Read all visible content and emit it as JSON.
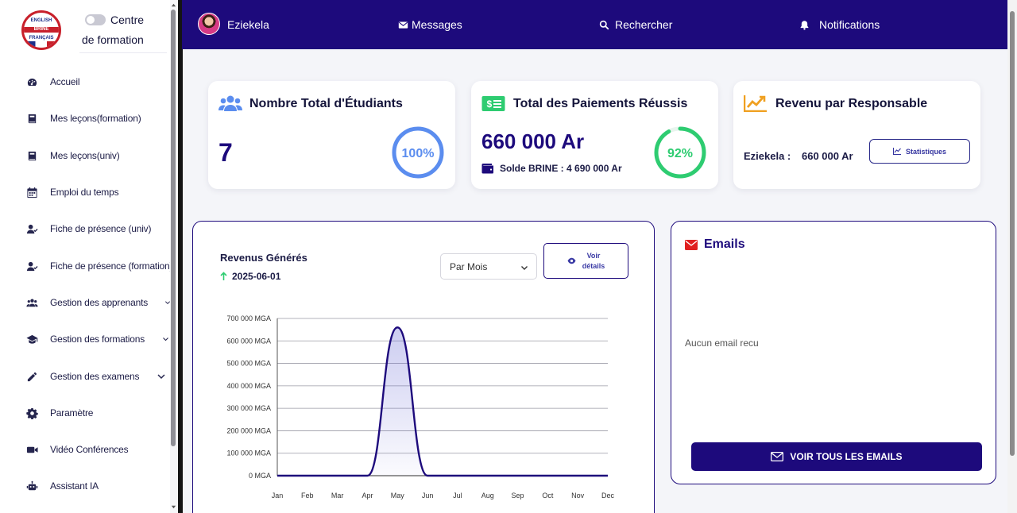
{
  "brand": {
    "logo_line1": "ENGLISH",
    "logo_line2": "BRINE",
    "logo_line3": "FRANÇAIS",
    "title_line1": "Centre",
    "title_line2": "de formation"
  },
  "sidebar": {
    "items": [
      {
        "label": "Accueil",
        "icon": "dashboard-icon"
      },
      {
        "label": "Mes leçons(formation)",
        "icon": "book-icon"
      },
      {
        "label": "Mes leçons(univ)",
        "icon": "book-icon"
      },
      {
        "label": "Emploi du temps",
        "icon": "calendar-icon"
      },
      {
        "label": "Fiche de présence (univ)",
        "icon": "user-check-icon"
      },
      {
        "label": "Fiche de présence (formation)",
        "icon": "user-check-icon"
      },
      {
        "label": "Gestion des apprenants",
        "icon": "users-icon"
      },
      {
        "label": "Gestion des formations",
        "icon": "graduation-cap-icon"
      },
      {
        "label": "Gestion des examens",
        "icon": "pencil-icon"
      },
      {
        "label": "Paramètre",
        "icon": "gear-icon"
      },
      {
        "label": "Vidéo Conférences",
        "icon": "video-icon"
      },
      {
        "label": "Assistant IA",
        "icon": "robot-icon"
      }
    ]
  },
  "header": {
    "user": "Eziekela",
    "messages": "Messages",
    "search": "Rechercher",
    "notifications": "Notifications"
  },
  "cards": {
    "students": {
      "title": "Nombre Total d'Étudiants",
      "value": "7",
      "percent_label": "100%",
      "percent": 100
    },
    "payments": {
      "title": "Total des Paiements Réussis",
      "value": "660 000 Ar",
      "balance": "Solde BRINE : 4 690 000 Ar",
      "percent_label": "92%",
      "percent": 92
    },
    "revenue": {
      "title": "Revenu par Responsable",
      "responsable": "Eziekela :",
      "amount": "660 000 Ar",
      "button": "Statistiques"
    }
  },
  "chart_panel": {
    "title": "Revenus Générés",
    "date": "2025-06-01",
    "period_select": "Par Mois",
    "details_button_line1": "Voir",
    "details_button_line2": "détails"
  },
  "chart_data": {
    "type": "area",
    "categories": [
      "Jan",
      "Feb",
      "Mar",
      "Apr",
      "May",
      "Jun",
      "Jul",
      "Aug",
      "Sep",
      "Oct",
      "Nov",
      "Dec"
    ],
    "series": [
      {
        "values": [
          0,
          0,
          0,
          0,
          660000,
          0,
          0,
          0,
          0,
          0,
          0,
          0
        ]
      }
    ],
    "ylim": [
      0,
      700000
    ],
    "yticks": [
      "0 MGA",
      "100 000 MGA",
      "200 000 MGA",
      "300 000 MGA",
      "400 000 MGA",
      "500 000 MGA",
      "600 000 MGA",
      "700 000 MGA"
    ],
    "grid": true,
    "line_color": "#1d0a7c"
  },
  "emails": {
    "title": "Emails",
    "empty": "Aucun email recu",
    "button": "VOIR TOUS LES EMAILS"
  },
  "colors": {
    "primary": "#1d0a7c",
    "ring_blue": "#5b8def",
    "ring_green": "#2ecc71",
    "accent_orange": "#f0a020",
    "accent_red": "#e02020"
  }
}
